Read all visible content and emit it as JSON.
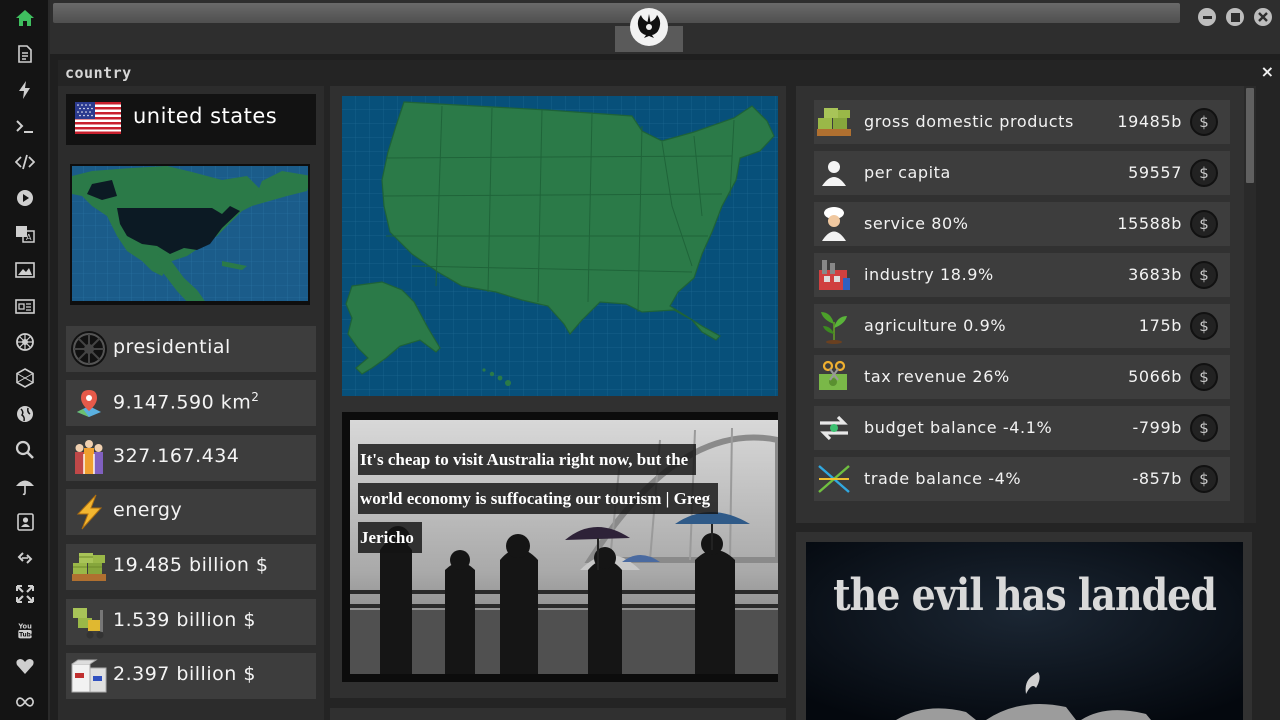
{
  "window": {
    "title": ""
  },
  "dock": {
    "items": [
      {
        "name": "home-icon"
      },
      {
        "name": "document-icon"
      },
      {
        "name": "bolt-icon"
      },
      {
        "name": "terminal-icon"
      },
      {
        "name": "code-icon"
      },
      {
        "name": "play-icon"
      },
      {
        "name": "translate-icon"
      },
      {
        "name": "image-icon"
      },
      {
        "name": "news-icon"
      },
      {
        "name": "empire-icon"
      },
      {
        "name": "hexagon-icon"
      },
      {
        "name": "globe-icon"
      },
      {
        "name": "search-icon"
      },
      {
        "name": "umbrella-icon"
      },
      {
        "name": "contact-icon"
      },
      {
        "name": "link-icon"
      },
      {
        "name": "expand-icon"
      },
      {
        "name": "youtube-icon"
      },
      {
        "name": "heart-icon"
      },
      {
        "name": "infinity-icon"
      }
    ],
    "accent": "#3fbf5f"
  },
  "panel": {
    "title": "country",
    "close": "×"
  },
  "country": {
    "name": "united states",
    "government": "presidential",
    "area": "9.147.590 km",
    "area_sup": "2",
    "population": "327.167.434",
    "energy": "energy",
    "gdp": "19.485 billion $",
    "exports": "1.539 billion $",
    "imports": "2.397 billion $"
  },
  "news": {
    "headline": "It's cheap to visit Australia right now, but the world economy is suffocating our tourism | Greg Jericho"
  },
  "stats": [
    {
      "icon": "money-stack-icon",
      "label": "gross domestic products",
      "value": "19485b"
    },
    {
      "icon": "person-icon",
      "label": "per capita",
      "value": "59557"
    },
    {
      "icon": "chef-icon",
      "label": "service 80%",
      "value": "15588b"
    },
    {
      "icon": "factory-icon",
      "label": "industry 18.9%",
      "value": "3683b"
    },
    {
      "icon": "plant-icon",
      "label": "agriculture 0.9%",
      "value": "175b"
    },
    {
      "icon": "tax-scissors-icon",
      "label": "tax revenue 26%",
      "value": "5066b"
    },
    {
      "icon": "balance-arrows-icon",
      "label": "budget balance -4.1%",
      "value": "-799b"
    },
    {
      "icon": "trade-cross-icon",
      "label": "trade balance -4%",
      "value": "-857b"
    }
  ],
  "currency_symbol": "$",
  "ad": {
    "text": "the evil has landed"
  },
  "colors": {
    "map_land": "#2b7a48",
    "map_water": "#07507a"
  }
}
